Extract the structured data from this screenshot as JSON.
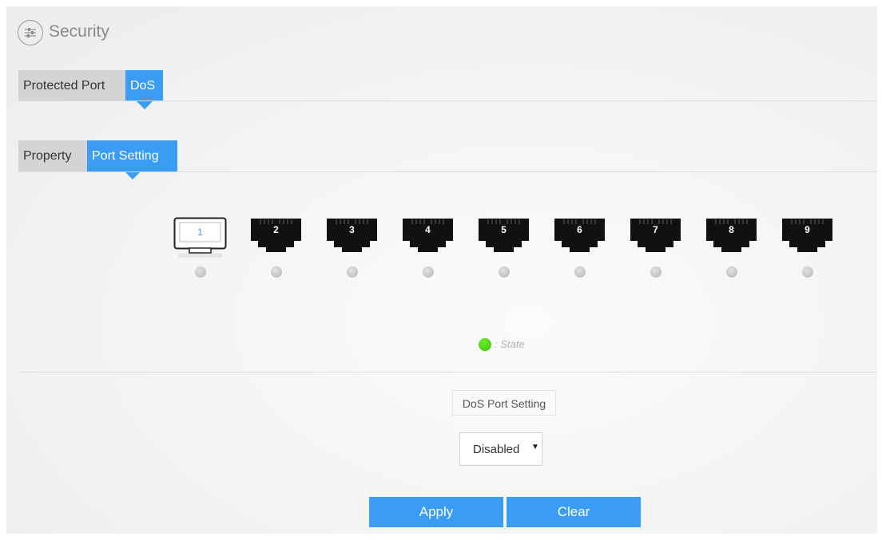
{
  "header": {
    "title": "Security",
    "icon": "sliders-icon"
  },
  "main_tabs": [
    {
      "label": "Protected Port",
      "active": false
    },
    {
      "label": "DoS",
      "active": true
    }
  ],
  "sub_tabs": [
    {
      "label": "Property",
      "active": false
    },
    {
      "label": "Port Setting",
      "active": true
    }
  ],
  "ports": [
    {
      "number": "1",
      "selected": true
    },
    {
      "number": "2",
      "selected": false
    },
    {
      "number": "3",
      "selected": false
    },
    {
      "number": "4",
      "selected": false
    },
    {
      "number": "5",
      "selected": false
    },
    {
      "number": "6",
      "selected": false
    },
    {
      "number": "7",
      "selected": false
    },
    {
      "number": "8",
      "selected": false
    },
    {
      "number": "9",
      "selected": false
    }
  ],
  "legend": {
    "text": ": State",
    "color": "#4cd417"
  },
  "dos_setting": {
    "label": "DoS Port Setting",
    "value": "Disabled",
    "options": [
      "Disabled"
    ]
  },
  "actions": {
    "apply": "Apply",
    "clear": "Clear"
  },
  "colors": {
    "accent": "#3a9cf5",
    "port_dark": "#111111"
  }
}
